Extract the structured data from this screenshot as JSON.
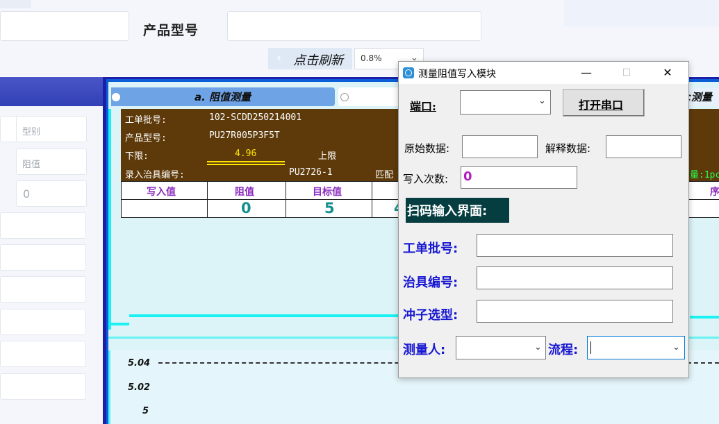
{
  "top_form": {
    "model_label": "产品型号",
    "refresh_label": "点击刷新",
    "refresh_chevron": "‹",
    "percent_value": "0.8%",
    "dropdown_arrow": "⌄"
  },
  "sidebar": {
    "placeholders": [
      "型别",
      "阻值",
      "0"
    ]
  },
  "monitor": {
    "tab_a_label": "a. 阻值测量",
    "tab_right_label": "c测量",
    "work_order_label": "工单批号:",
    "work_order_value": "102-SCDD250214001",
    "product_model_label": "产品型号:",
    "product_model_value": "PU27R005P3F5T",
    "lower_limit_label": "下限:",
    "lower_limit_value": "4.96",
    "upper_limit_label": "上限",
    "fixture_label": "录入治具编号:",
    "fixture_value": "PU2726-1",
    "match_label": "匹配",
    "right_edge_text": "量:1pc",
    "table_headers": [
      "写入值",
      "阻值",
      "目标值"
    ],
    "table_values": [
      "",
      "0",
      "5",
      "4"
    ],
    "right_col_header": "序",
    "chart_ticks": [
      "5.04",
      "5.02",
      "5"
    ]
  },
  "dialog": {
    "title": "测量阻值写入模块",
    "minimize": "—",
    "maximize": "☐",
    "close": "✕",
    "port_label": "端口:",
    "port_value": "",
    "open_serial_label": "打开串口",
    "raw_data_label": "原始数据:",
    "raw_data_value": "",
    "decoded_label": "解释数据:",
    "decoded_value": "",
    "write_count_label": "写入次数:",
    "write_count_value": "0",
    "write_count_color": "#b020c0",
    "scan_title": "扫码输入界面:",
    "work_order_label": "工单批号:",
    "fixture_label": "治具编号:",
    "punch_label": "冲子选型:",
    "measurer_label": "测量人:",
    "process_label": "流程:",
    "combo_arrow": "⌄"
  }
}
